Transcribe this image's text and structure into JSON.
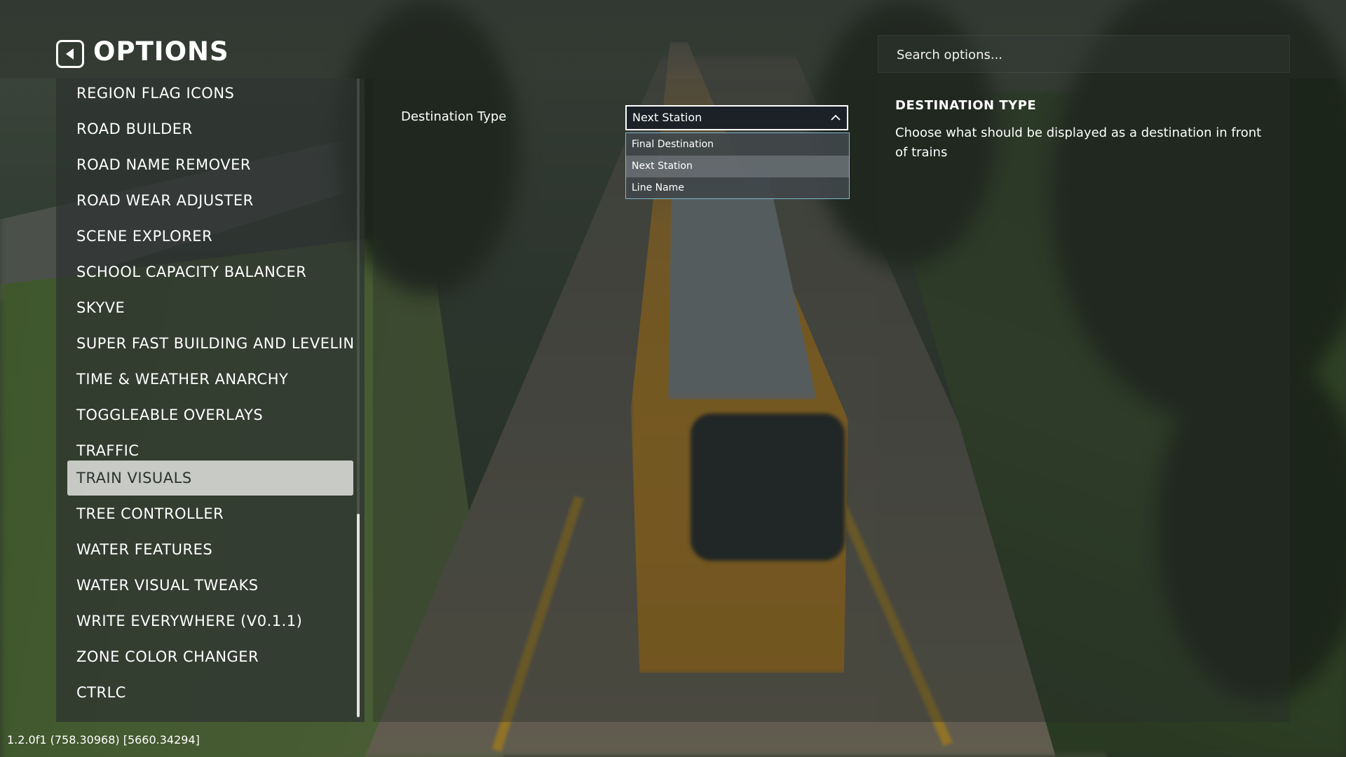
{
  "header": {
    "title": "OPTIONS",
    "back_icon": "back-arrow-icon"
  },
  "search": {
    "placeholder": "Search options..."
  },
  "categories": [
    {
      "label": "REGION FLAG ICONS",
      "selected": false
    },
    {
      "label": "ROAD BUILDER",
      "selected": false
    },
    {
      "label": "ROAD NAME REMOVER",
      "selected": false
    },
    {
      "label": "ROAD WEAR ADJUSTER",
      "selected": false
    },
    {
      "label": "SCENE EXPLORER",
      "selected": false
    },
    {
      "label": "SCHOOL CAPACITY BALANCER",
      "selected": false
    },
    {
      "label": "SKYVE",
      "selected": false
    },
    {
      "label": "SUPER FAST BUILDING AND LEVELIN",
      "selected": false
    },
    {
      "label": "TIME & WEATHER ANARCHY",
      "selected": false
    },
    {
      "label": "TOGGLEABLE OVERLAYS",
      "selected": false
    },
    {
      "label": "TRAFFIC",
      "selected": false
    },
    {
      "label": "TRAIN VISUALS",
      "selected": true
    },
    {
      "label": "TREE CONTROLLER",
      "selected": false
    },
    {
      "label": "WATER FEATURES",
      "selected": false
    },
    {
      "label": "WATER VISUAL TWEAKS",
      "selected": false
    },
    {
      "label": "WRITE EVERYWHERE (V0.1.1)",
      "selected": false
    },
    {
      "label": "ZONE COLOR CHANGER",
      "selected": false
    },
    {
      "label": "CTRLC",
      "selected": false
    }
  ],
  "option": {
    "label": "Destination Type",
    "selected_value": "Next Station",
    "expanded": true,
    "choices": [
      "Final Destination",
      "Next Station",
      "Line Name"
    ]
  },
  "description": {
    "title": "DESTINATION TYPE",
    "text": "Choose what should be displayed as a destination in front of trains"
  },
  "footer": {
    "version": "1.2.0f1 (758.30968) [5660.34294]"
  },
  "colors": {
    "selected_item_bg": "#dcdeda",
    "dropdown_bg": "#1b2126",
    "dropdown_border": "#ffffff",
    "menu_border": "#7fb8d0"
  }
}
